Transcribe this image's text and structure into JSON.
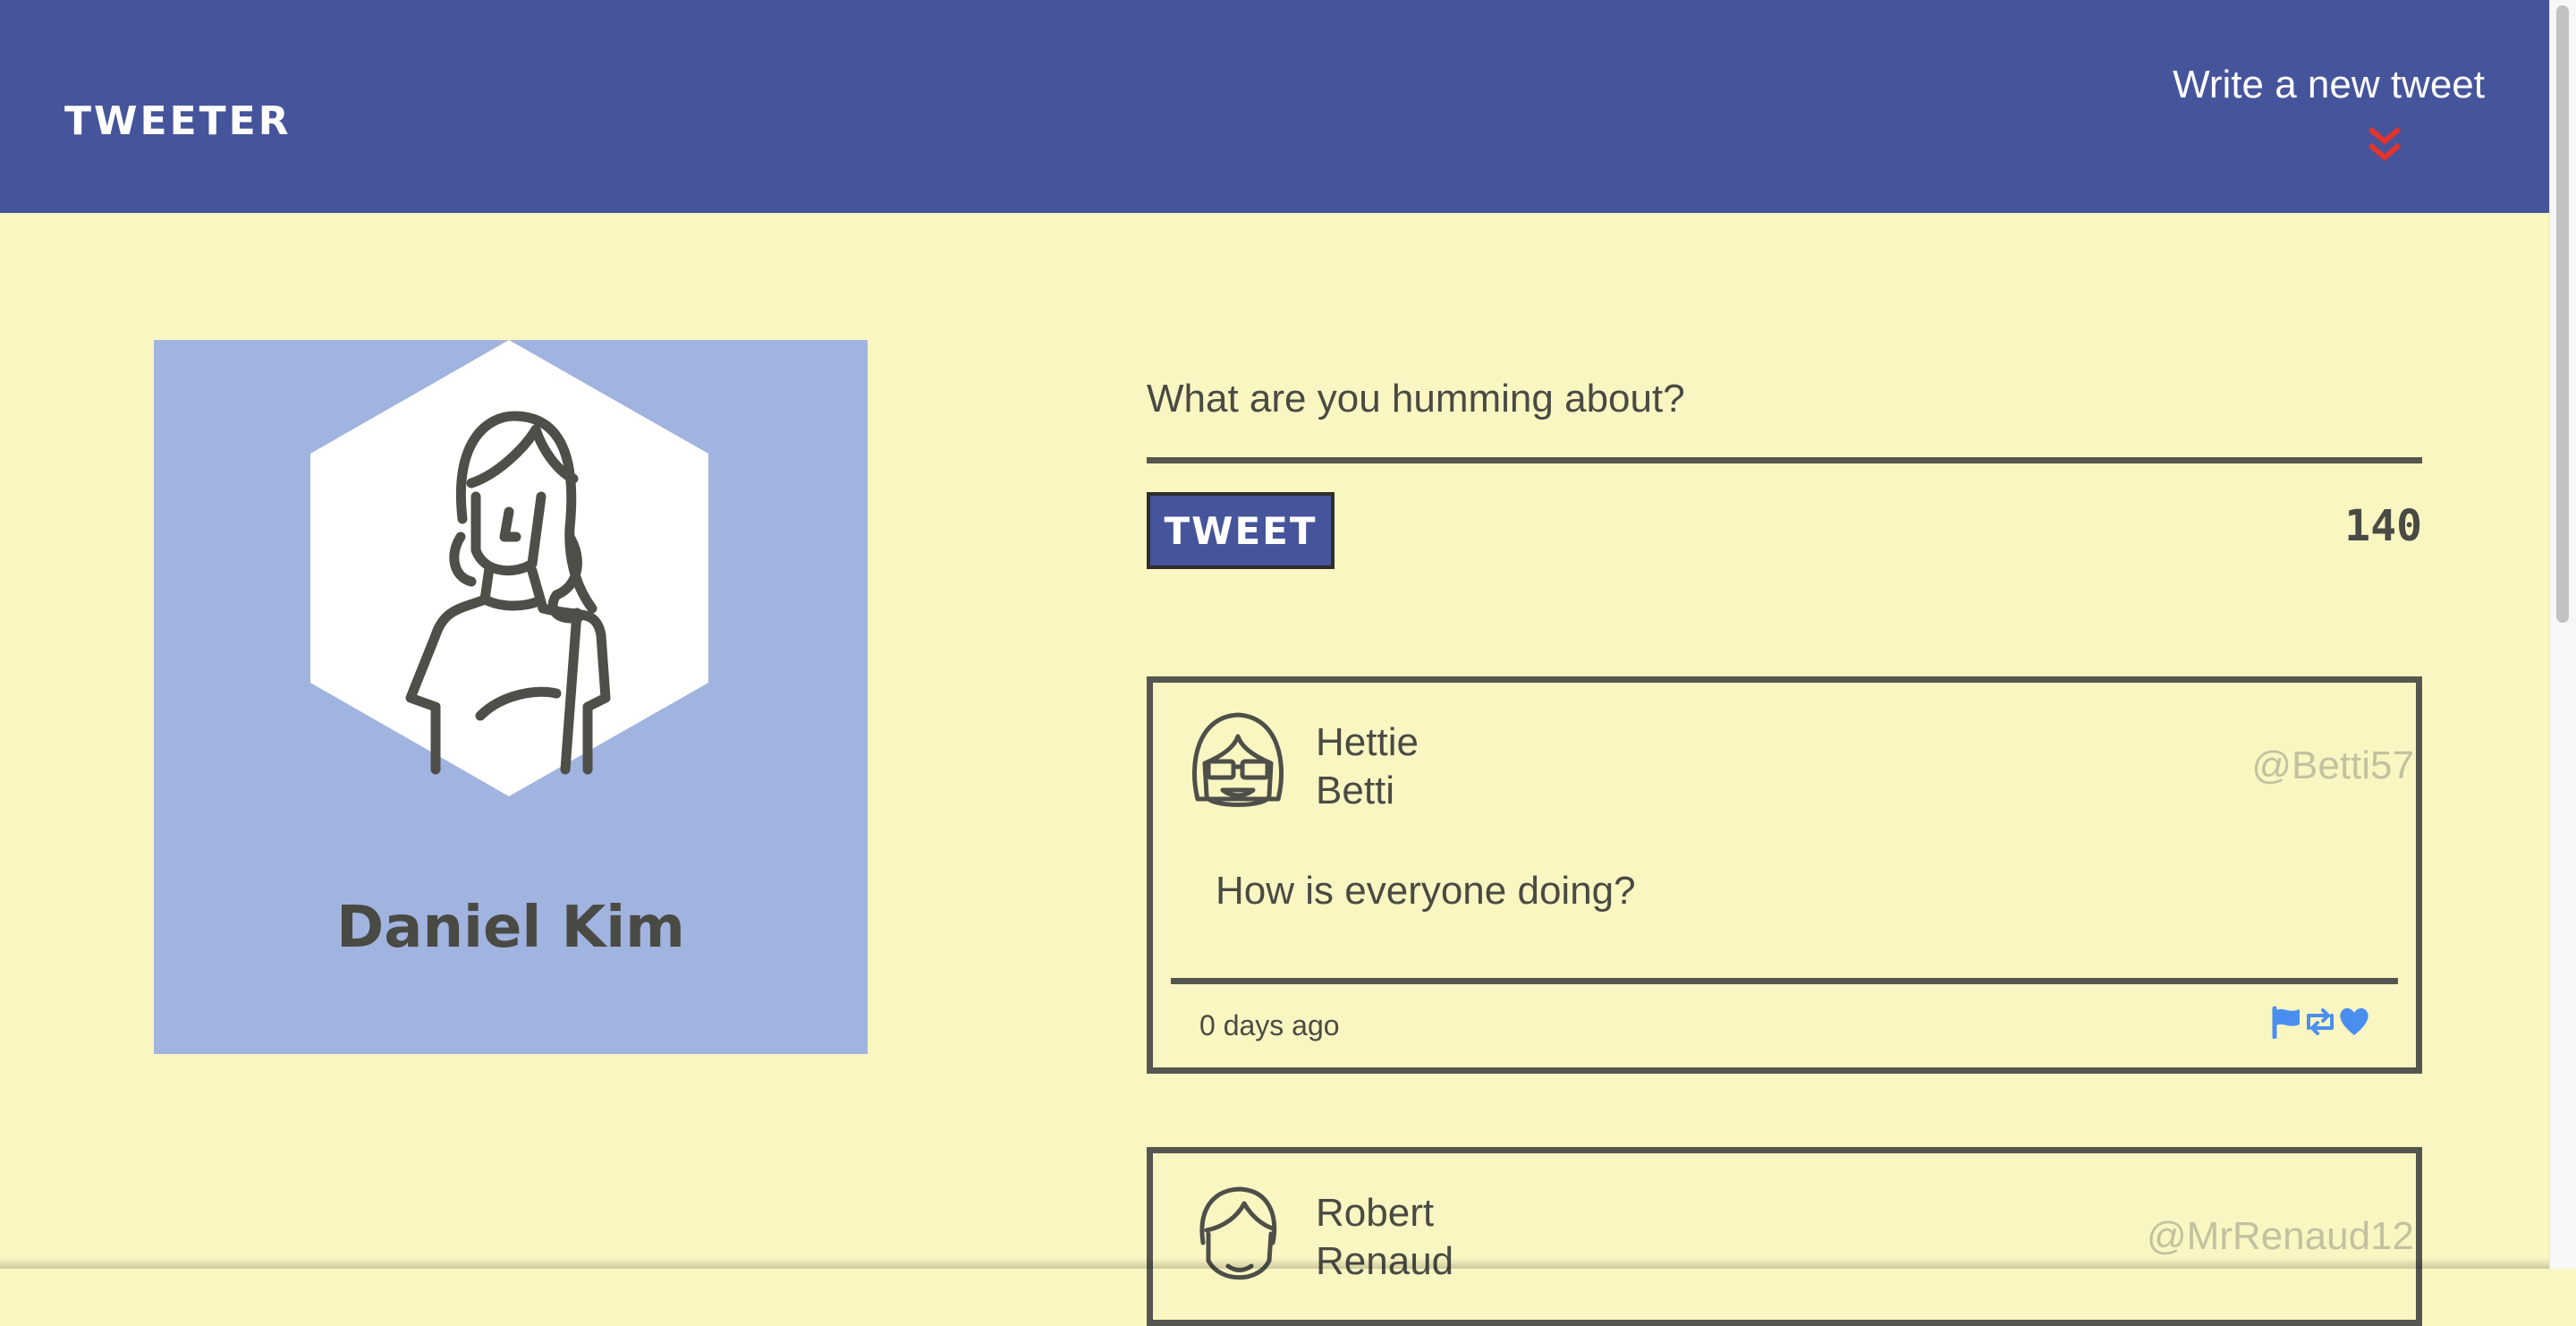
{
  "nav": {
    "brand": "TWEETER",
    "write_label": "Write a new tweet",
    "chevron_icon": "double-chevron-down-icon",
    "bg_color": "#45549b",
    "accent_color": "#e0342c"
  },
  "profile": {
    "name": "Daniel Kim",
    "avatar_icon": "woman-avatar-icon",
    "card_color": "#a1b3df"
  },
  "composer": {
    "placeholder": "What are you humming about?",
    "button_label": "TWEET",
    "counter": "140"
  },
  "tweets": [
    {
      "first_name": "Hettie",
      "last_name": "Betti",
      "handle": "@Betti57",
      "body": "How is everyone doing?",
      "time": "0 days ago",
      "avatar_icon": "sunglasses-avatar-icon",
      "actions": [
        "flag-icon",
        "retweet-icon",
        "heart-icon"
      ]
    },
    {
      "first_name": "Robert",
      "last_name": "Renaud",
      "handle": "@MrRenaud12",
      "avatar_icon": "man-avatar-icon"
    }
  ],
  "colors": {
    "background": "#faf6c2",
    "text": "#4a4a44",
    "handle": "#c4c1a0",
    "action_icons": "#4a8ff0"
  }
}
